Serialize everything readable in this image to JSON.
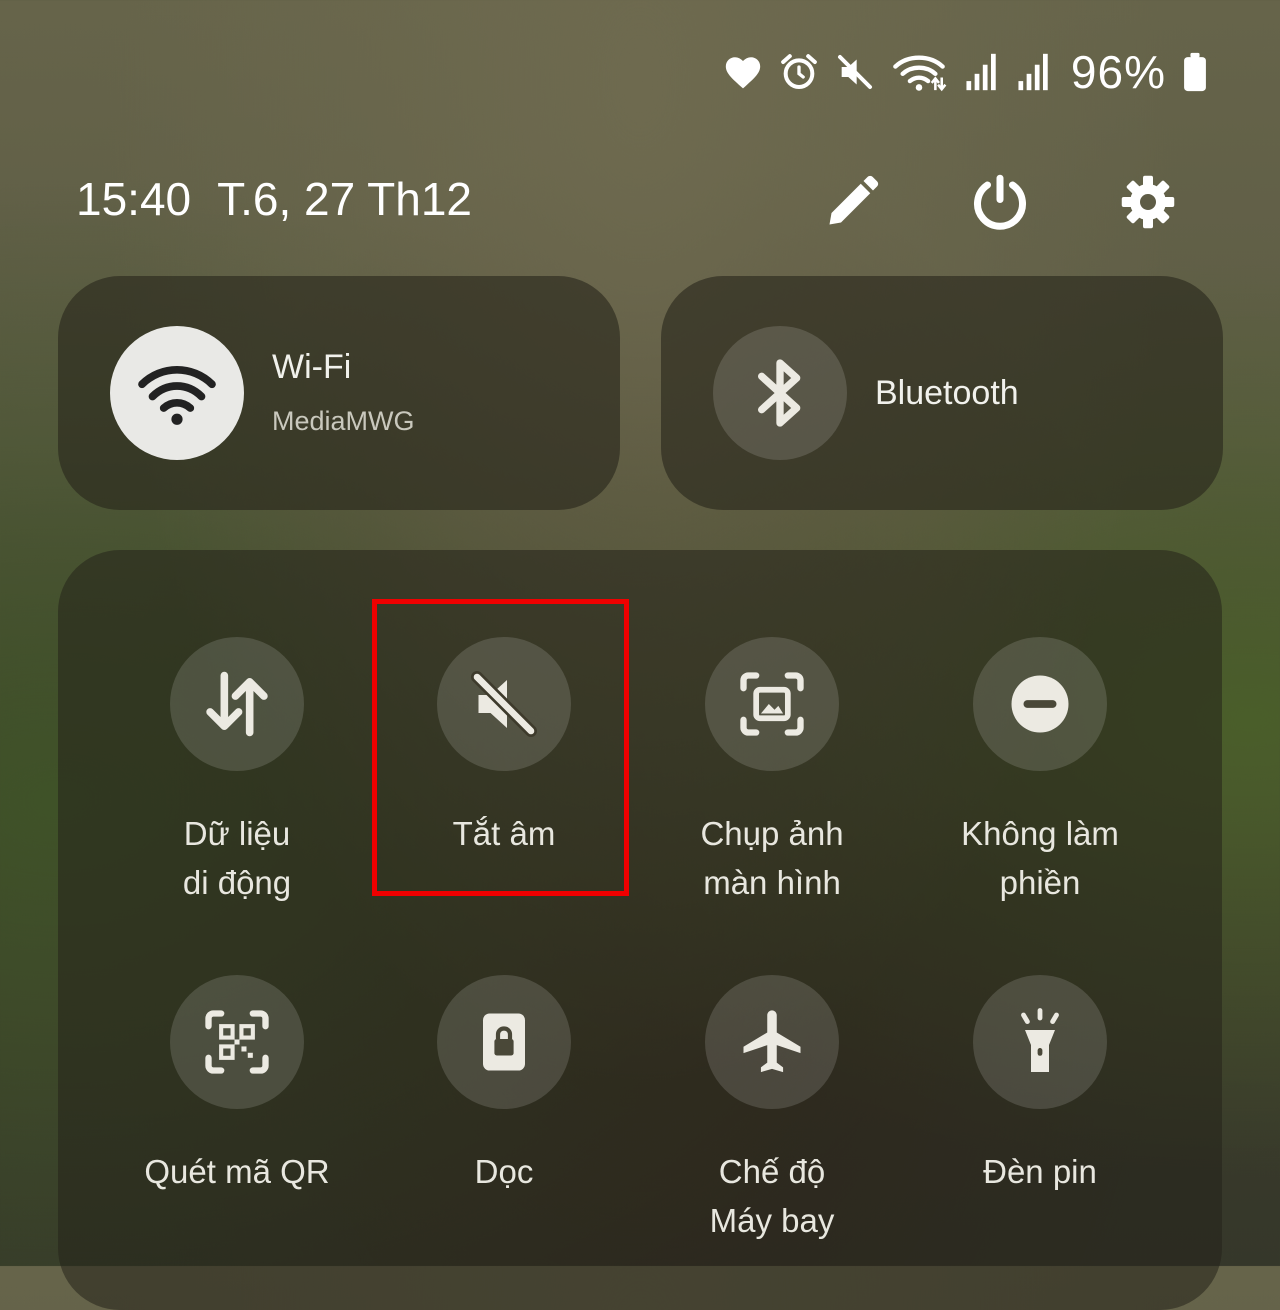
{
  "status_bar": {
    "icons": [
      "heart-icon",
      "alarm-icon",
      "mute-icon",
      "wifi-icon",
      "signal-icon",
      "signal-icon",
      "battery-icon"
    ],
    "battery_text": "96%"
  },
  "header": {
    "time": "15:40",
    "date": "T.6, 27 Th12",
    "buttons": [
      "edit-icon",
      "power-icon",
      "settings-icon"
    ]
  },
  "big_tiles": {
    "wifi": {
      "title": "Wi-Fi",
      "subtitle": "MediaMWG",
      "state": "on"
    },
    "bluetooth": {
      "title": "Bluetooth",
      "state": "off"
    }
  },
  "grid": {
    "tiles": [
      {
        "id": "mobile-data",
        "icon": "data-transfer-icon",
        "lines": [
          "Dữ liệu",
          "di động"
        ]
      },
      {
        "id": "mute",
        "icon": "mute-icon",
        "lines": [
          "Tắt âm"
        ]
      },
      {
        "id": "screenshot",
        "icon": "screenshot-icon",
        "lines": [
          "Chụp ảnh",
          "màn hình"
        ]
      },
      {
        "id": "dnd",
        "icon": "do-not-disturb-icon",
        "lines": [
          "Không làm",
          "phiền"
        ]
      },
      {
        "id": "qr",
        "icon": "qr-scan-icon",
        "lines": [
          "Quét mã QR"
        ]
      },
      {
        "id": "portrait",
        "icon": "portrait-lock-icon",
        "lines": [
          "Dọc"
        ]
      },
      {
        "id": "airplane",
        "icon": "airplane-icon",
        "lines": [
          "Chế độ",
          "Máy bay"
        ]
      },
      {
        "id": "flashlight",
        "icon": "flashlight-icon",
        "lines": [
          "Đèn pin"
        ]
      }
    ]
  },
  "annotation": {
    "highlight_color": "#ef0000",
    "highlighted_tile": "mute"
  },
  "colors": {
    "tile_bg": "#2a281c",
    "icon_on_bg": "#e9e9e6",
    "text": "#f2f2ee"
  }
}
